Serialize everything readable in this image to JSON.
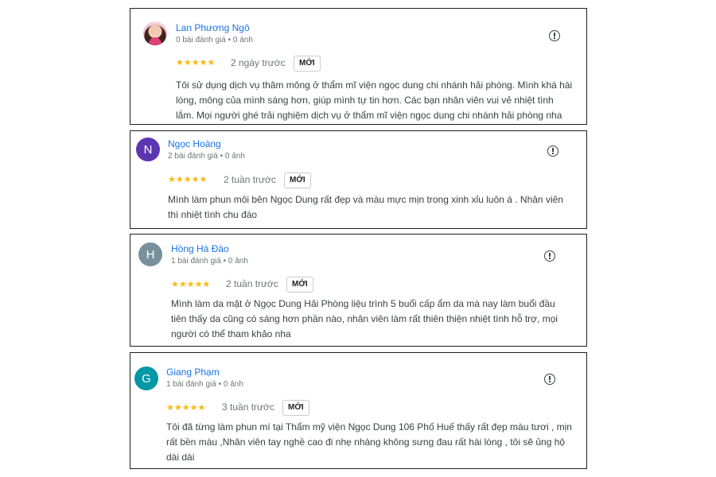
{
  "reviews": [
    {
      "name": "Lan Phương Ngô",
      "avatar_letter": "",
      "avatar_type": "photo",
      "stats": "0 bài đánh giá • 0 ảnh",
      "stars": "★★★★★",
      "rating": 5,
      "time": "2 ngày trước",
      "badge": "MỚI",
      "text": "Tôi sử dụng dịch vụ thâm mông ở thẩm mĩ viện ngọc dung chi nhánh hải phòng. Mình khá hài lòng, mông của mình sáng hơn, giúp mình tự tin hơn. Các bạn nhân viên vui vẻ nhiệt tình lắm. Mọi người ghé trải nghiệm dịch vụ ở thẩm mĩ viện ngọc dung chi nhánh hải phòng nha"
    },
    {
      "name": "Ngọc Hoàng",
      "avatar_letter": "N",
      "avatar_color": "#5e35b1",
      "stats": "2 bài đánh giá • 0 ảnh",
      "stars": "★★★★★",
      "rating": 5,
      "time": "2 tuần trước",
      "badge": "MỚI",
      "text": "Mình làm phun môi bên Ngọc Dung rất đẹp và màu mực mịn trong xinh xỉu luôn á . Nhân viên thì nhiệt tình chu đáo"
    },
    {
      "name": "Hồng Hà Đào",
      "avatar_letter": "H",
      "avatar_color": "#78909c",
      "stats": "1 bài đánh giá • 0 ảnh",
      "stars": "★★★★★",
      "rating": 5,
      "time": "2 tuần trước",
      "badge": "MỚI",
      "text": "Mình làm da mặt ở Ngọc Dung Hải Phòng liệu trình 5 buổi cấp ẩm da mà nay làm buổi đầu tiên thấy da cũng có sáng hơn phần nào, nhân viên làm rất thiên thiện nhiệt tình hỗ trợ, mọi người có thể tham khảo nha"
    },
    {
      "name": "Giang Phạm",
      "avatar_letter": "G",
      "avatar_color": "#0097a7",
      "stats": "1 bài đánh giá • 0 ảnh",
      "stars": "★★★★★",
      "rating": 5,
      "time": "3 tuần trước",
      "badge": "MỚI",
      "text": "Tôi đã từng làm phun mí tại Thẩm mỹ viện Ngọc Dung 106 Phố Huế thấy rất đẹp màu tươi , mịn rất bền màu ,Nhân viên tay nghề cao đi nhẹ nhàng không sưng đau rất hài lòng , tôi sẽ ủng hộ dài dài"
    }
  ],
  "colors": {
    "name": "#1a73e8",
    "stars": "#f9b90b",
    "border": "#1f1f1f"
  },
  "icons": {
    "report": "report-flag-icon"
  }
}
